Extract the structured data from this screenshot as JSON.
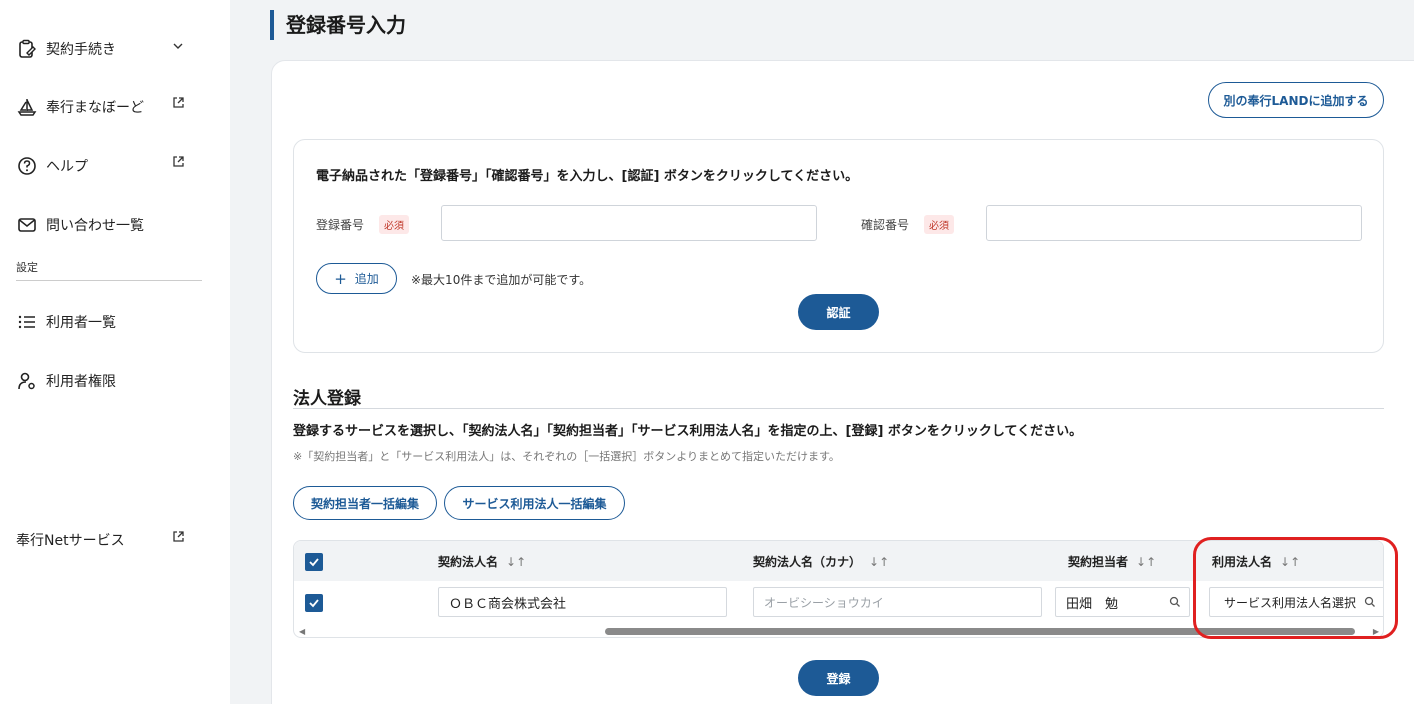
{
  "sidebar": {
    "items": [
      {
        "label": "契約手続き",
        "icon": "clipboard-edit-icon",
        "suffix": "chevron-down-icon"
      },
      {
        "label": "奉行まなぼーど",
        "icon": "sailboat-icon",
        "suffix": "external-link-icon"
      },
      {
        "label": "ヘルプ",
        "icon": "help-circle-icon",
        "suffix": "external-link-icon"
      },
      {
        "label": "問い合わせ一覧",
        "icon": "mail-icon",
        "suffix": ""
      }
    ],
    "settings_label": "設定",
    "settings_items": [
      {
        "label": "利用者一覧",
        "icon": "list-icon"
      },
      {
        "label": "利用者権限",
        "icon": "user-gear-icon"
      }
    ],
    "net_service": {
      "label": "奉行Netサービス",
      "icon": "external-link-icon"
    }
  },
  "page": {
    "title": "登録番号入力",
    "add_land_button": "別の奉行LANDに追加する"
  },
  "registration": {
    "instruction": "電子納品された「登録番号」「確認番号」を入力し、[認証] ボタンをクリックしてください。",
    "reg_number_label": "登録番号",
    "confirm_number_label": "確認番号",
    "required_badge": "必須",
    "reg_number_value": "",
    "confirm_number_value": "",
    "add_button": "追加",
    "add_note": "※最大10件まで追加が可能です。",
    "auth_button": "認証"
  },
  "corporate": {
    "section_title": "法人登録",
    "instruction": "登録するサービスを選択し、「契約法人名」「契約担当者」「サービス利用法人名」を指定の上、[登録] ボタンをクリックしてください。",
    "sub_note": "※「契約担当者」と「サービス利用法人」は、それぞれの［一括選択］ボタンよりまとめて指定いただけます。",
    "bulk_contact_button": "契約担当者一括編集",
    "bulk_service_button": "サービス利用法人一括編集",
    "table": {
      "headers": [
        "契約法人名",
        "契約法人名（カナ）",
        "契約担当者",
        "利用法人名"
      ],
      "sort_glyph": "↓↑",
      "rows": [
        {
          "checked": true,
          "corp_name": "ＯＢＣ商会株式会社",
          "corp_kana_placeholder": "オービシーショウカイ",
          "contact": "田畑　勉",
          "service_corp": "サービス利用法人名選択"
        }
      ]
    },
    "register_button": "登録"
  },
  "colors": {
    "primary": "#1d5a96",
    "highlight": "#e02020",
    "required": "#c0392b"
  }
}
